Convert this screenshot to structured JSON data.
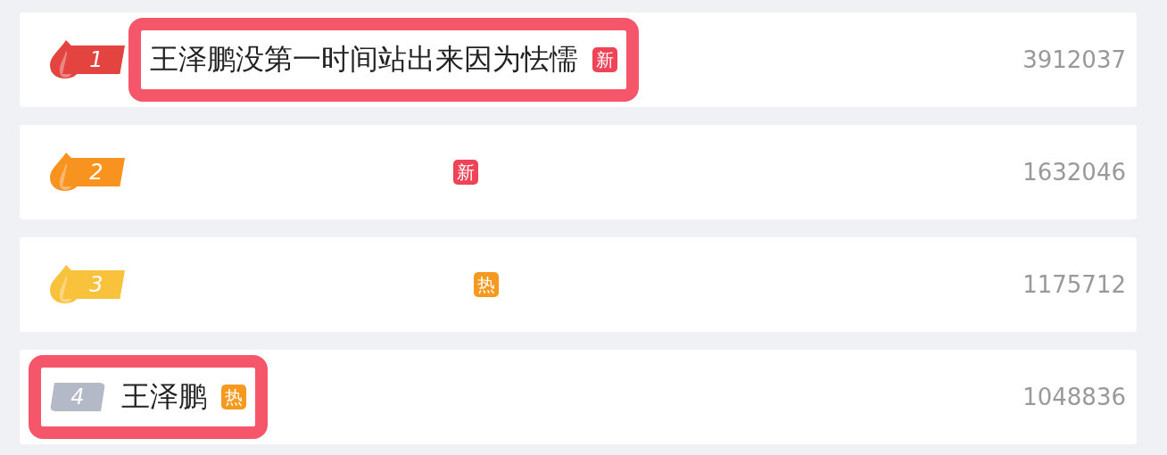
{
  "hot_list": [
    {
      "rank": "1",
      "color": "#e4443f",
      "flame": true,
      "title": "王泽鹏没第一时间站出来因为怯懦",
      "tag": {
        "text": "新",
        "color": "#ef4358"
      },
      "heat": "3912037",
      "kind": "framed_title"
    },
    {
      "rank": "2",
      "color": "#f7931e",
      "flame": true,
      "tag": {
        "text": "新",
        "color": "#ef4358"
      },
      "heat": "1632046",
      "kind": "plain"
    },
    {
      "rank": "3",
      "color": "#f8c23c",
      "flame": true,
      "tag": {
        "text": "热",
        "color": "#f59a1e"
      },
      "heat": "1175712",
      "kind": "plain"
    },
    {
      "rank": "4",
      "color": "#b3b9c6",
      "flame": false,
      "title": "王泽鹏",
      "tag": {
        "text": "热",
        "color": "#f59a1e"
      },
      "heat": "1048836",
      "kind": "framed_row"
    }
  ]
}
